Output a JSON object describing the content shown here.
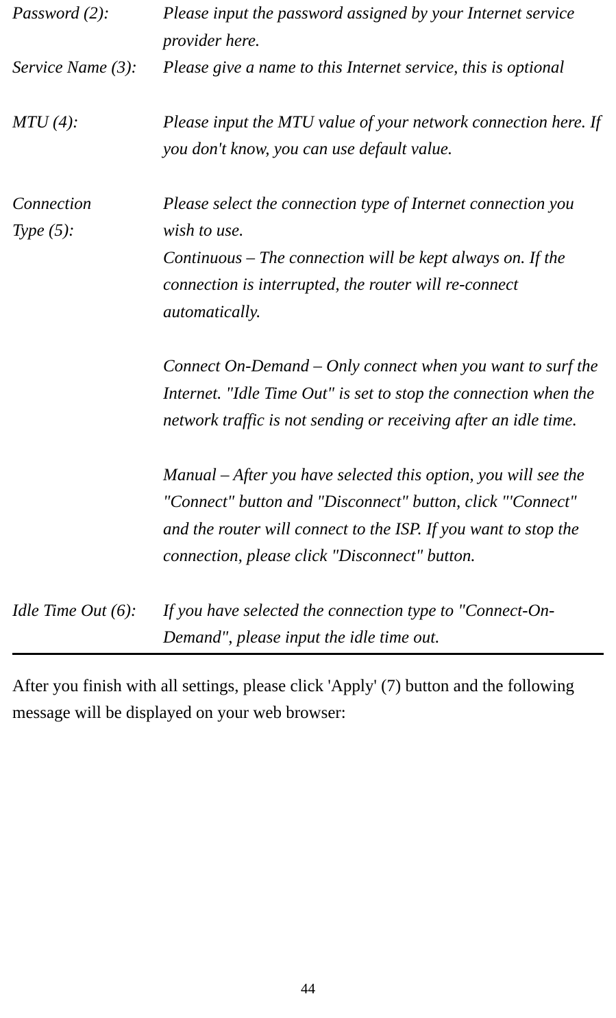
{
  "rows": {
    "password": {
      "label": "Password (2):",
      "value": "Please input the password assigned by your Internet service provider here."
    },
    "service_name": {
      "label": "Service Name (3):",
      "value": "Please give a name to this Internet service, this is optional"
    },
    "mtu": {
      "label": "MTU (4):",
      "value": "Please input the MTU value of your network connection here. If you don't know, you can use default value."
    },
    "connection_type": {
      "label_line1": "Connection",
      "label_line2": "Type (5):",
      "p1": "Please select the connection type of Internet connection you wish to use.",
      "p2": "Continuous – The connection will be kept always on. If the connection is interrupted, the router will re-connect automatically.",
      "p3": "Connect On-Demand – Only connect when you want to surf the Internet. \"Idle Time Out\" is set to stop the connection when the network traffic is not sending or receiving after an idle time.",
      "p4": "Manual – After you have selected this option, you will see the \"Connect\" button and \"Disconnect\" button, click \"'Connect\" and the router will connect to the ISP. If you want to stop the connection, please click \"Disconnect\" button."
    },
    "idle_time_out": {
      "label": "Idle Time Out (6):",
      "value": "If you have selected the connection type to \"Connect-On-Demand\", please input the idle time out."
    }
  },
  "closing_text": "After you finish with all settings, please click 'Apply' (7) button and the following message will be displayed on your web browser:",
  "page_number": "44"
}
